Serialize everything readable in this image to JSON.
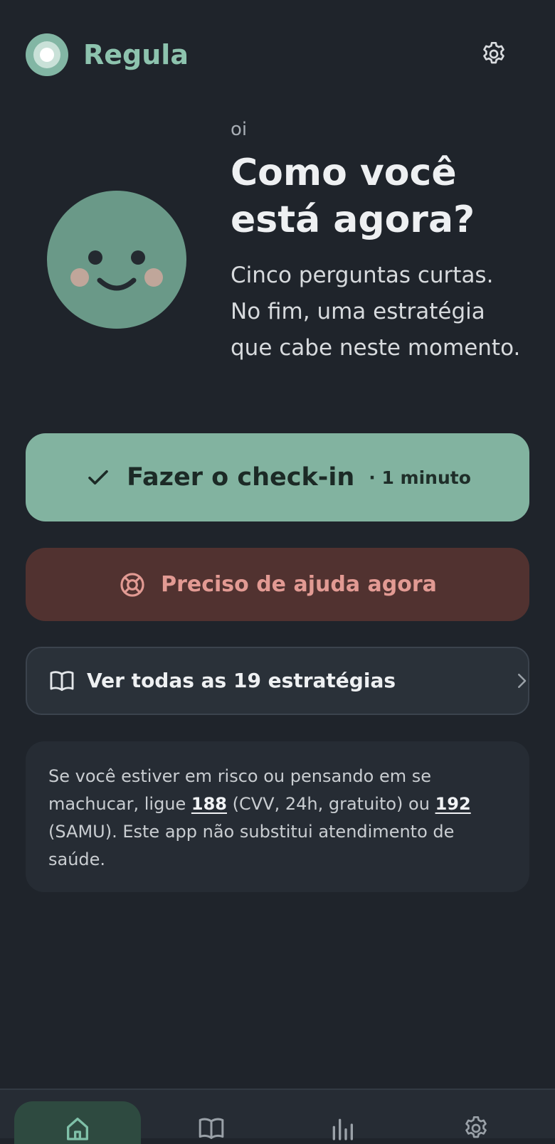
{
  "header": {
    "app_title": "Regula",
    "settings_icon": "gear-icon"
  },
  "hero": {
    "greeting": "oi",
    "title": "Como você está agora?",
    "subtitle": "Cinco perguntas curtas. No fim, uma estratégia que cabe neste momento.",
    "illustration": "smiling-face-illustration"
  },
  "actions": {
    "checkin_label": "Fazer o check-in",
    "checkin_meta": "· 1 minuto",
    "checkin_icon": "check-icon",
    "help_label": "Preciso de ajuda agora",
    "help_icon": "lifebuoy-icon",
    "strategies_label": "Ver todas as 19 estratégias",
    "strategies_icon": "book-icon",
    "strategies_chevron": "chevron-right-icon"
  },
  "notice": {
    "part1": "Se você estiver em risco ou pensando em se machucar, ligue ",
    "number1": "188",
    "part2": " (CVV, 24h, gratuito) ou ",
    "number2": "192",
    "part3": " (SAMU). Este app não substitui atendimento de saúde."
  },
  "bottom_nav": {
    "items": [
      {
        "icon": "home-icon",
        "active": true
      },
      {
        "icon": "book-icon",
        "active": false
      },
      {
        "icon": "bar-chart-icon",
        "active": false
      },
      {
        "icon": "gear-icon",
        "active": false
      }
    ]
  },
  "colors": {
    "background": "#1f242b",
    "accent": "#82b3a0",
    "danger_bg": "#513230",
    "danger_text": "#e29a93"
  }
}
